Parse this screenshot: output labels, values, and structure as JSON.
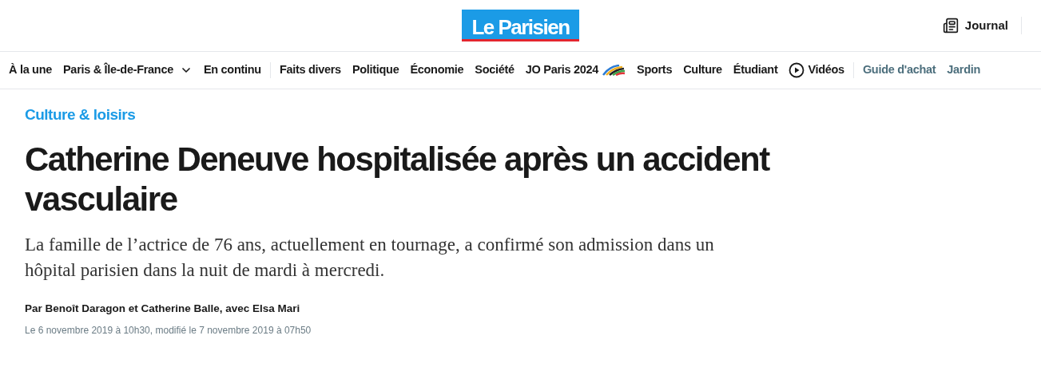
{
  "header": {
    "logo": "Le Parisien",
    "journal": "Journal"
  },
  "nav": [
    {
      "label": "À la une",
      "kind": "link",
      "divider_before": false
    },
    {
      "label": "Paris & Île-de-France",
      "kind": "dropdown",
      "divider_before": false
    },
    {
      "label": "En continu",
      "kind": "link",
      "divider_before": false
    },
    {
      "label": "Faits divers",
      "kind": "link",
      "divider_before": true
    },
    {
      "label": "Politique",
      "kind": "link",
      "divider_before": false
    },
    {
      "label": "Économie",
      "kind": "link",
      "divider_before": false
    },
    {
      "label": "Société",
      "kind": "link",
      "divider_before": false
    },
    {
      "label": "JO Paris 2024",
      "kind": "olympic",
      "divider_before": false
    },
    {
      "label": "Sports",
      "kind": "link",
      "divider_before": false
    },
    {
      "label": "Culture",
      "kind": "link",
      "divider_before": false
    },
    {
      "label": "Étudiant",
      "kind": "link",
      "divider_before": false
    },
    {
      "label": "Vidéos",
      "kind": "video",
      "divider_before": false
    },
    {
      "label": "Guide d'achat",
      "kind": "partner",
      "divider_before": true
    },
    {
      "label": "Jardin",
      "kind": "partner",
      "divider_before": false
    }
  ],
  "article": {
    "category": "Culture & loisirs",
    "title": "Catherine Deneuve hospitalisée après un accident vasculaire",
    "subtitle": "La famille de l’actrice de 76 ans, actuellement en tournage, a confirmé son admission dans un hôpital parisien dans la nuit de mardi à mercredi.",
    "byline": "Par Benoît Daragon et Catherine Balle, avec Elsa Mari",
    "date": "Le 6 novembre 2019 à 10h30, modifié le 7 novembre 2019 à 07h50"
  }
}
